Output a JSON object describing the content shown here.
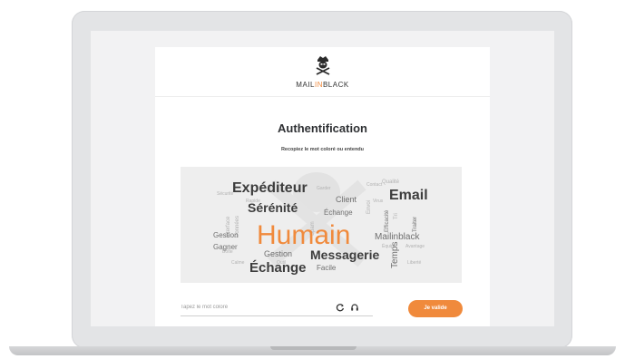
{
  "brand": {
    "name_part1": "MAIL",
    "name_part2": "IN",
    "name_part3": "BLACK"
  },
  "auth": {
    "title": "Authentification",
    "instruction": "Recopiez le mot coloré ou entendu"
  },
  "wordcloud": {
    "highlight": "Humain",
    "main_words": [
      "Expéditeur",
      "Sérénité",
      "Email",
      "Échange",
      "Messagerie",
      "Client",
      "Échange",
      "Gestion",
      "Gagner",
      "Gestion",
      "Facile",
      "Mailinblack",
      "Temps",
      "Efficacité"
    ],
    "faint_words": [
      "Sécurité",
      "Garder",
      "Envoi",
      "Contact",
      "Qualité",
      "Traiter",
      "Interface",
      "Données",
      "Spam",
      "Virus",
      "Équipe",
      "Avantage",
      "Liberté",
      "Outil",
      "Tri",
      "Calme",
      "Boîte",
      "Rapide"
    ]
  },
  "form": {
    "placeholder": "Tapez le mot coloré",
    "submit_label": "Je valide"
  },
  "icons": {
    "refresh": "refresh-icon",
    "audio": "headphones-icon",
    "logo": "pirate-mascot-icon"
  },
  "colors": {
    "accent": "#f08a3c",
    "text_dark": "#2f3134",
    "cloud_bg": "#eeeeee"
  }
}
